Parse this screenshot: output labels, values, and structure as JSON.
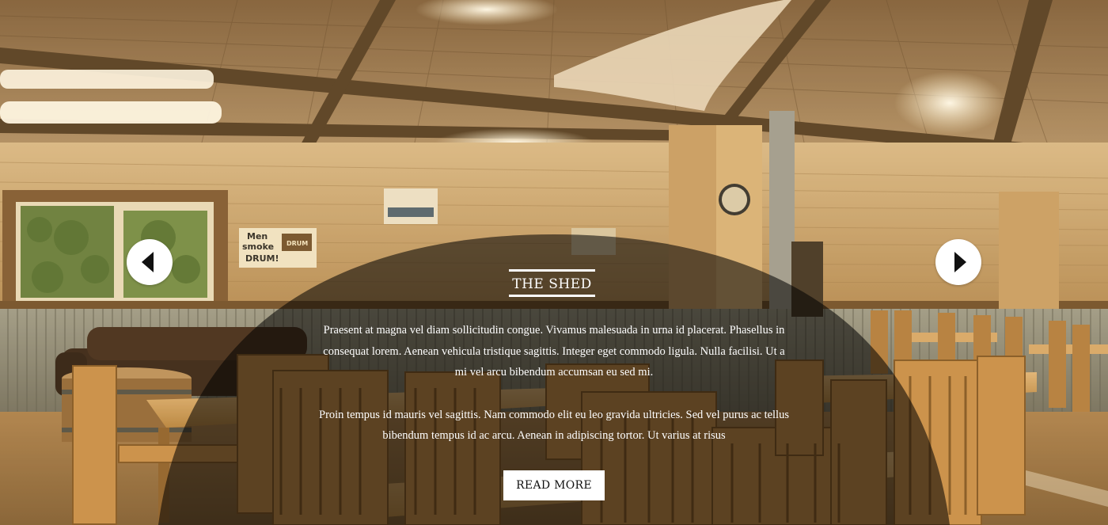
{
  "slide": {
    "title": "THE SHED",
    "paragraphs": [
      "Praesent at magna vel diam sollicitudin congue. Vivamus malesuada in urna id placerat. Phasellus in consequat lorem. Aenean vehicula tristique sagittis. Integer eget commodo ligula. Nulla facilisi. Ut a mi vel arcu bibendum accumsan eu sed mi.",
      "Proin tempus id mauris vel sagittis. Nam commodo elit eu leo gravida ultricies. Sed vel purus ac tellus bibendum tempus id ac arcu. Aenean in adipiscing tortor. Ut varius at risus"
    ],
    "button_label": "READ MORE",
    "background_image": "wooden-shed-interior-photo",
    "wall_signs": {
      "sign_left_line1": "Men",
      "sign_left_line2": "smoke",
      "sign_left_line3": "DRUM!",
      "sign_left_small": "DRUM"
    }
  },
  "navigation": {
    "prev_icon": "arrow-left-icon",
    "next_icon": "arrow-right-icon"
  },
  "colors": {
    "overlay": "#000000",
    "button_bg": "#ffffff",
    "button_text": "#111111",
    "caption_text": "#ffffff",
    "wood": "#c9a26a"
  }
}
